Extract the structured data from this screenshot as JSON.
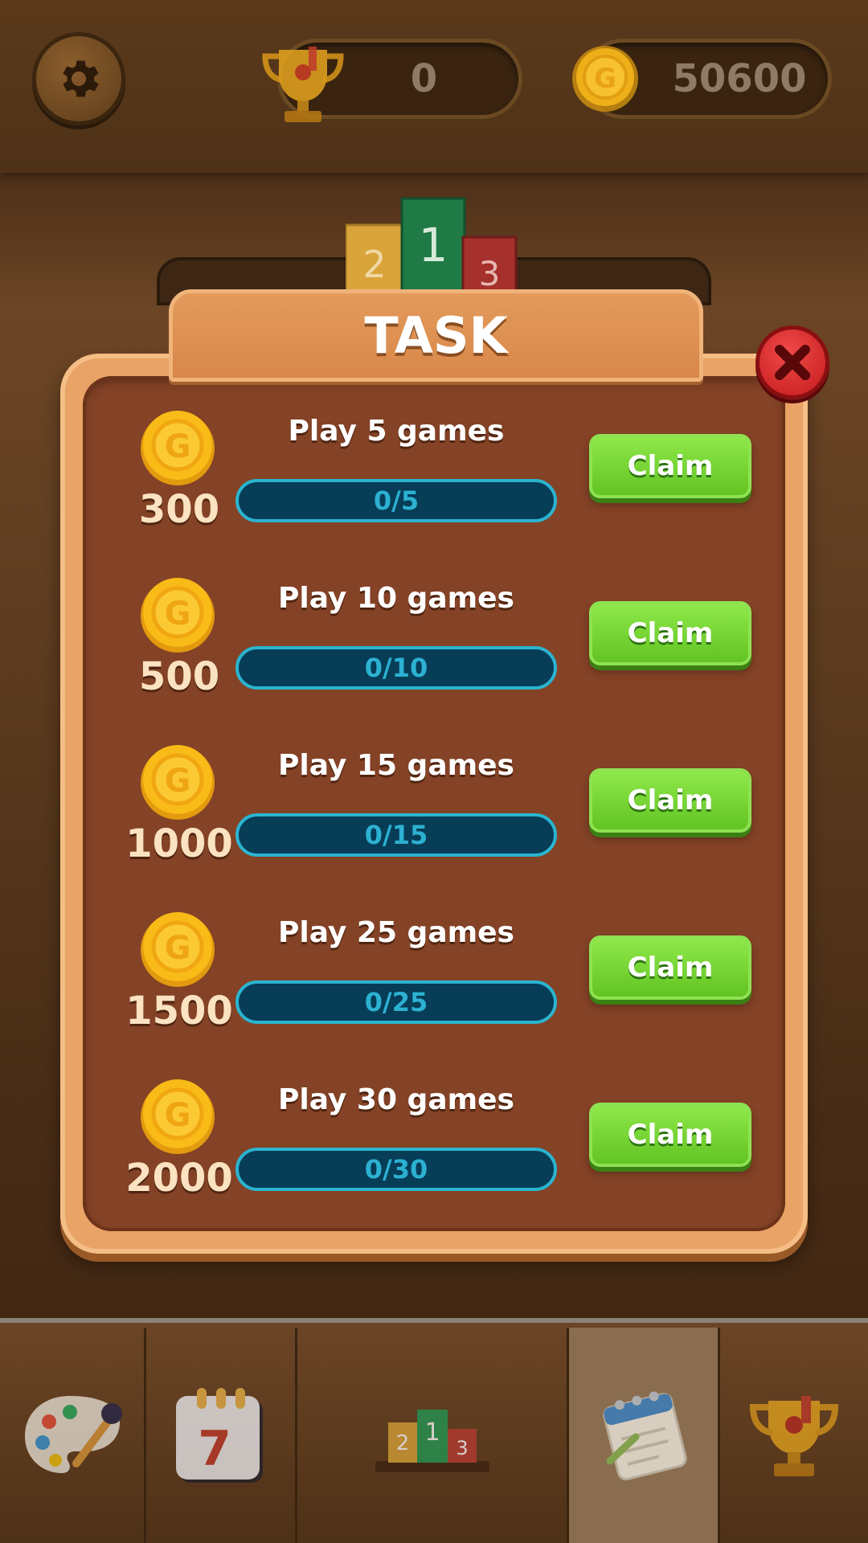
{
  "header": {
    "settings_icon": "gear-icon",
    "trophies": "0",
    "coins": "50600"
  },
  "podium_numbers": [
    "2",
    "1",
    "3"
  ],
  "dialog": {
    "title": "TASK",
    "close_icon": "close-icon",
    "tasks": [
      {
        "reward": "300",
        "name": "Play 5 games",
        "progress_text": "0/5",
        "progress": 0,
        "claim_label": "Claim"
      },
      {
        "reward": "500",
        "name": "Play 10 games",
        "progress_text": "0/10",
        "progress": 0,
        "claim_label": "Claim"
      },
      {
        "reward": "1000",
        "name": "Play 15 games",
        "progress_text": "0/15",
        "progress": 0,
        "claim_label": "Claim"
      },
      {
        "reward": "1500",
        "name": "Play 25 games",
        "progress_text": "0/25",
        "progress": 0,
        "claim_label": "Claim"
      },
      {
        "reward": "2000",
        "name": "Play 30 games",
        "progress_text": "0/30",
        "progress": 0,
        "claim_label": "Claim"
      }
    ]
  },
  "bottom_nav": {
    "items": [
      {
        "icon": "palette-icon"
      },
      {
        "icon": "calendar-icon",
        "day": "7"
      },
      {
        "icon": "podium-icon",
        "numbers": [
          "2",
          "1",
          "3"
        ]
      },
      {
        "icon": "task-notebook-icon",
        "active": true
      },
      {
        "icon": "trophy-icon"
      }
    ]
  },
  "colors": {
    "accent_green": "#62c423",
    "progress_blue": "#2bb4d0",
    "close_red": "#d42226",
    "coin_gold": "#f9b81a"
  }
}
